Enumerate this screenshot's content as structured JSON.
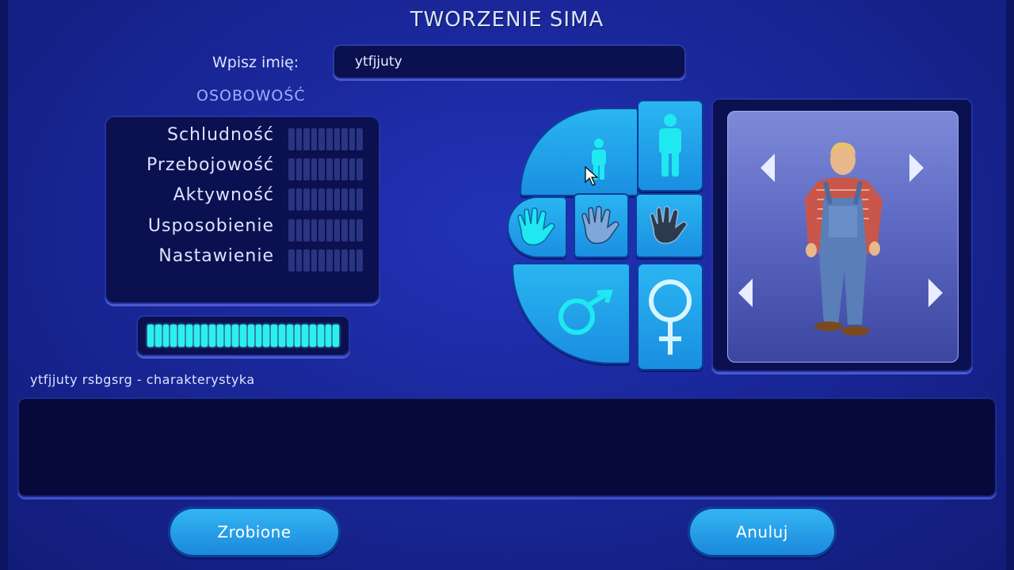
{
  "screen": {
    "title": "TWORZENIE SIMA",
    "name_label": "Wpisz imię:",
    "name_value": "ytfjjuty",
    "personality_title": "OSOBOWOŚĆ"
  },
  "traits": [
    {
      "label": "Schludność",
      "level": 0,
      "max": 10
    },
    {
      "label": "Przebojowość",
      "level": 0,
      "max": 10
    },
    {
      "label": "Aktywność",
      "level": 0,
      "max": 10
    },
    {
      "label": "Usposobienie",
      "level": 0,
      "max": 10
    },
    {
      "label": "Nastawienie",
      "level": 0,
      "max": 10
    }
  ],
  "remaining_points": {
    "level": 25,
    "max": 25
  },
  "characteristic_label": "ytfjjuty rsbgsrg - charakterystyka",
  "selector": {
    "age_selected": "child",
    "skin_selected": "light",
    "gender_selected": "male",
    "icons": [
      "child-icon",
      "adult-icon",
      "hand-light-icon",
      "hand-medium-icon",
      "hand-dark-icon",
      "male-icon",
      "female-icon"
    ]
  },
  "buttons": {
    "done": "Zrobione",
    "cancel": "Anuluj"
  },
  "colors": {
    "background": "#1a279a",
    "panel": "#0a1050",
    "accent": "#2ab6f2",
    "bar_fill": "#2af0f0"
  }
}
